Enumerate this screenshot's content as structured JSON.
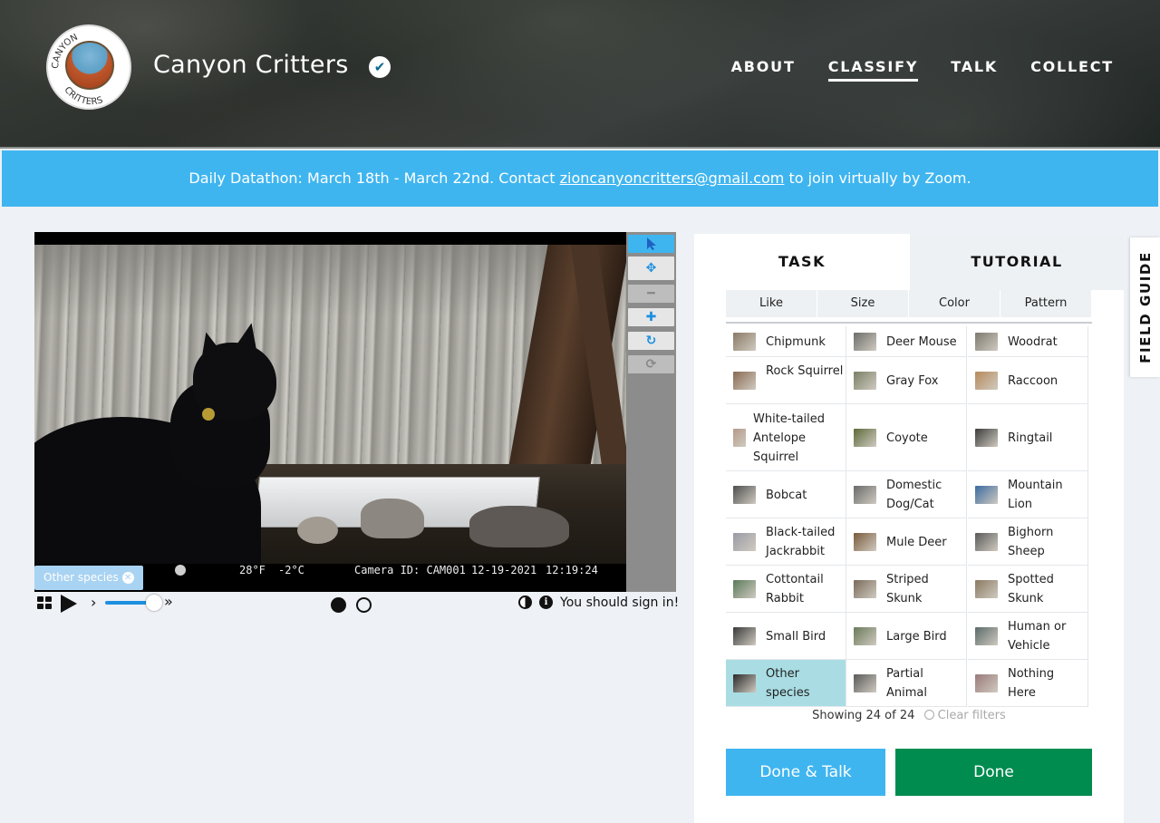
{
  "header": {
    "logo_alt": "Canyon Critters",
    "title": "Canyon Critters",
    "nav": [
      {
        "label": "ABOUT",
        "active": false
      },
      {
        "label": "CLASSIFY",
        "active": true
      },
      {
        "label": "TALK",
        "active": false
      },
      {
        "label": "COLLECT",
        "active": false
      }
    ]
  },
  "banner": {
    "text_before": "Daily Datathon: March 18th - March 22nd. Contact ",
    "email": "zioncanyoncritters@gmail.com",
    "text_after": " to join virtually by Zoom."
  },
  "viewer": {
    "stamp": {
      "temp_f": "28°F",
      "temp_c": "-2°C",
      "camera": "Camera ID: CAM001",
      "date": "12-19-2021",
      "time": "12:19:24"
    },
    "tag": "Other species",
    "tools": [
      "pointer-icon",
      "move-icon",
      "zoom-out-icon",
      "zoom-in-icon",
      "rotate-icon",
      "reset-icon"
    ],
    "signin_text": "You should sign in!"
  },
  "panel": {
    "tabs": {
      "task": "TASK",
      "tutorial": "TUTORIAL"
    },
    "filters": [
      "Like",
      "Size",
      "Color",
      "Pattern"
    ],
    "species": [
      {
        "label": "Chipmunk",
        "color": "#8b7a66"
      },
      {
        "label": "Deer Mouse",
        "color": "#6d6d6a"
      },
      {
        "label": "Woodrat",
        "color": "#7d7a70"
      },
      {
        "label": "Rock Squirrel",
        "color": "#8a6a52"
      },
      {
        "label": "Gray Fox",
        "color": "#7a8066"
      },
      {
        "label": "Raccoon",
        "color": "#b88a5a"
      },
      {
        "label": "White-tailed Antelope Squirrel",
        "color": "#b59a8a"
      },
      {
        "label": "Coyote",
        "color": "#5e6a3a"
      },
      {
        "label": "Ringtail",
        "color": "#3c3c3c"
      },
      {
        "label": "Bobcat",
        "color": "#4e4e4e"
      },
      {
        "label": "Domestic Dog/Cat",
        "color": "#6a6a6a"
      },
      {
        "label": "Mountain Lion",
        "color": "#3a6aa0"
      },
      {
        "label": "Black-tailed Jackrabbit",
        "color": "#9a9aa6"
      },
      {
        "label": "Mule Deer",
        "color": "#7a5a3a"
      },
      {
        "label": "Bighorn Sheep",
        "color": "#5a5a5a"
      },
      {
        "label": "Cottontail Rabbit",
        "color": "#5a7a5a"
      },
      {
        "label": "Striped Skunk",
        "color": "#7a6a5a"
      },
      {
        "label": "Spotted Skunk",
        "color": "#8a7a60"
      },
      {
        "label": "Small Bird",
        "color": "#3a3a3a"
      },
      {
        "label": "Large Bird",
        "color": "#6a7a5a"
      },
      {
        "label": "Human or Vehicle",
        "color": "#5a6a6a"
      },
      {
        "label": "Other species",
        "color": "#2a2a2a"
      },
      {
        "label": "Partial Animal",
        "color": "#5a5a5a"
      },
      {
        "label": "Nothing Here",
        "color": "#9a7a7a"
      }
    ],
    "showing": "Showing 24 of 24",
    "clear_filters": "Clear filters",
    "done_talk": "Done & Talk",
    "done": "Done"
  },
  "field_guide": "FIELD GUIDE",
  "colors": {
    "accent_blue": "#3fb5f0",
    "done_green": "#008b4f",
    "highlight": "#a9dde3"
  }
}
